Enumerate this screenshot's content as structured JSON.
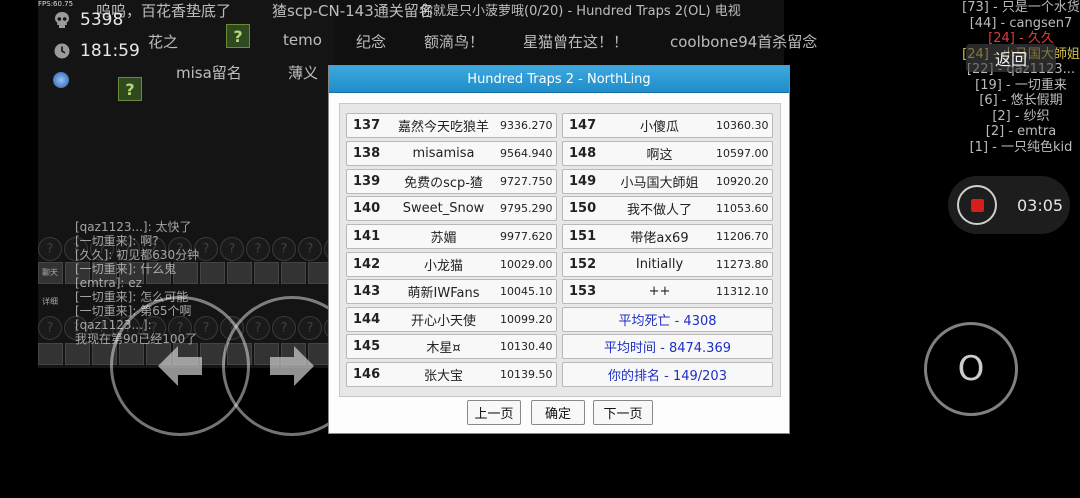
{
  "hud": {
    "fps": "FPS:60.75",
    "deaths": "5398",
    "time": "181:59",
    "labels": {
      "chat": "聊天",
      "detail": "详细"
    }
  },
  "danmaku": [
    "呜呜，百花香垫底了",
    "猹scp-CN-143通关留名",
    "你就是只小菠萝哦(0/20) - Hundred Traps 2(OL) 电视",
    "花之",
    "temo",
    "纪念",
    "额滴鸟！",
    "星猫曾在这！！",
    "coolbone94首杀留念",
    "misa留名",
    "薄义"
  ],
  "chat_log": [
    "[qaz1123...]: 太快了",
    "[一切重来]: 啊?",
    "[久久]: 初见都630分钟",
    "[一切重来]: 什么鬼",
    "[emtra]: ez",
    "[一切重来]: 怎么可能",
    "[一切重来]: 第65个啊",
    "[qaz1123...]: ",
    "我现在第90已经100了"
  ],
  "ranking_overlay": [
    "[73] - 只是一个水货",
    "[44] - cangsen7",
    "[24] - 久久",
    "[24] - 小马国大師姐",
    "[22] - qaz1123...",
    "[19] - 一切重来",
    "[6] - 悠长假期",
    "[2] - 纱织",
    "[2] - emtra",
    "[1] - 一只纯色kid"
  ],
  "back_button": "返回",
  "recording": {
    "time": "03:05",
    "accent": "#d51e1e"
  },
  "jump_button": "O",
  "dialog": {
    "title": "Hundred Traps 2 - NorthLing",
    "accent": "#1f8dcb",
    "left_entries": [
      {
        "rank": "137",
        "name": "嘉然今天吃狼羊",
        "time": "9336.270"
      },
      {
        "rank": "138",
        "name": "misamisa",
        "time": "9564.940"
      },
      {
        "rank": "139",
        "name": "免费のscp-猹",
        "time": "9727.750"
      },
      {
        "rank": "140",
        "name": "Sweet_Snow",
        "time": "9795.290"
      },
      {
        "rank": "141",
        "name": "苏媚",
        "time": "9977.620"
      },
      {
        "rank": "142",
        "name": "小龙猫",
        "time": "10029.00"
      },
      {
        "rank": "143",
        "name": "萌新IWFans",
        "time": "10045.10"
      },
      {
        "rank": "144",
        "name": "开心小天使",
        "time": "10099.20"
      },
      {
        "rank": "145",
        "name": "木星¤",
        "time": "10130.40"
      },
      {
        "rank": "146",
        "name": "张大宝",
        "time": "10139.50"
      }
    ],
    "right_entries": [
      {
        "rank": "147",
        "name": "小傻瓜",
        "time": "10360.30"
      },
      {
        "rank": "148",
        "name": "啊这",
        "time": "10597.00"
      },
      {
        "rank": "149",
        "name": "小马国大師姐",
        "time": "10920.20"
      },
      {
        "rank": "150",
        "name": "我不做人了",
        "time": "11053.60"
      },
      {
        "rank": "151",
        "name": "带佬ax69",
        "time": "11206.70"
      },
      {
        "rank": "152",
        "name": "Initially",
        "time": "11273.80"
      },
      {
        "rank": "153",
        "name": "++",
        "time": "11312.10"
      }
    ],
    "stats": {
      "avg_deaths": "平均死亡 - 4308",
      "avg_time": "平均时间 - 8474.369",
      "your_rank": "你的排名 - 149/203"
    },
    "buttons": {
      "prev": "上一页",
      "ok": "确定",
      "next": "下一页"
    }
  }
}
